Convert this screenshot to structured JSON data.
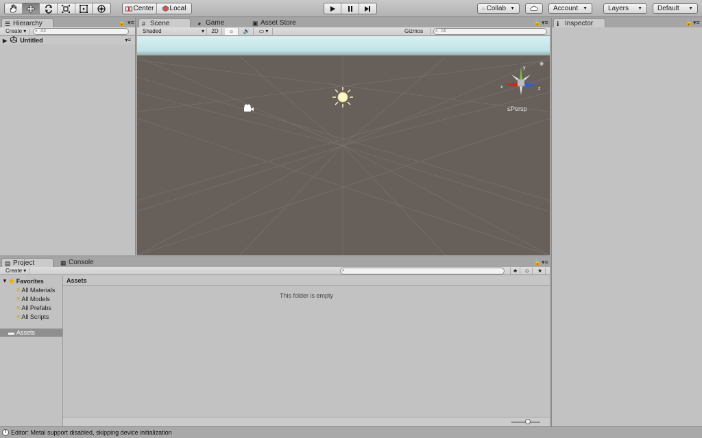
{
  "toolbar": {
    "center_label": "Center",
    "local_label": "Local",
    "collab_label": "Collab",
    "account_label": "Account",
    "layers_label": "Layers",
    "layout_label": "Default"
  },
  "hierarchy": {
    "tab_label": "Hierarchy",
    "create_label": "Create",
    "search_placeholder": "All",
    "scene_name": "Untitled"
  },
  "scene_view": {
    "tabs": [
      {
        "label": "Scene"
      },
      {
        "label": "Game"
      },
      {
        "label": "Asset Store"
      }
    ],
    "shading_mode": "Shaded",
    "mode_2d_label": "2D",
    "gizmos_label": "Gizmos",
    "search_placeholder": "All",
    "projection_label": "Persp",
    "axis_labels": {
      "x": "x",
      "y": "y",
      "z": "z"
    },
    "colors": {
      "sky": "#cfe9ec",
      "ground": "#665f5a",
      "grid": "#7a726d",
      "x_axis": "#c8291d",
      "y_axis": "#7ac531",
      "z_axis": "#2f5cde"
    }
  },
  "inspector": {
    "tab_label": "Inspector"
  },
  "project": {
    "tabs": [
      {
        "label": "Project"
      },
      {
        "label": "Console"
      }
    ],
    "create_label": "Create",
    "favorites_label": "Favorites",
    "favorites": [
      {
        "label": "All Materials"
      },
      {
        "label": "All Models"
      },
      {
        "label": "All Prefabs"
      },
      {
        "label": "All Scripts"
      }
    ],
    "assets_label": "Assets",
    "breadcrumb": "Assets",
    "empty_message": "This folder is empty"
  },
  "status_bar": {
    "message": "Editor: Metal support disabled, skipping device initialization"
  }
}
